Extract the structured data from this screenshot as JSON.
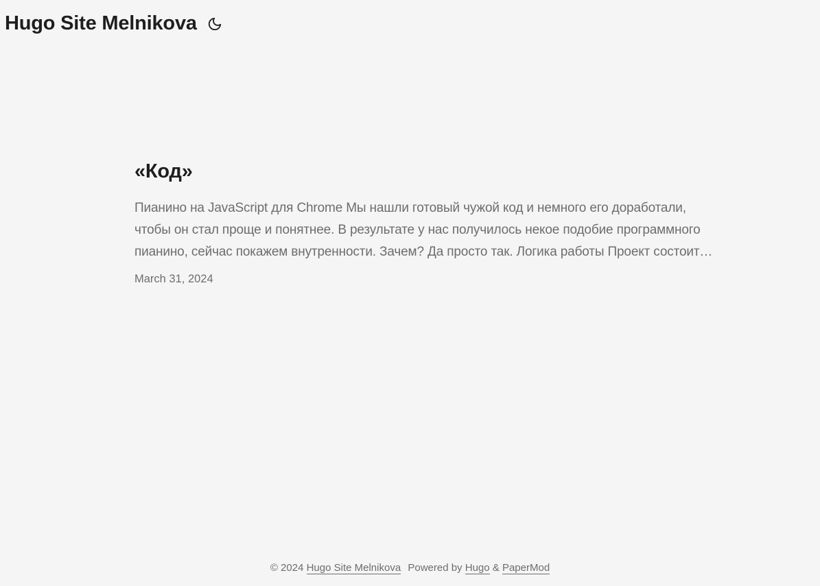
{
  "header": {
    "site_title": "Hugo Site Melnikova",
    "theme_toggle_icon": "moon-icon"
  },
  "post": {
    "title": "«Код»",
    "summary_lines": [
      "Пианино на JavaScript для Chrome Мы нашли готовый чужой код и немного его доработали,",
      "чтобы он стал проще и понятнее. В результате у нас получилось некое подобие программного",
      "пианино, сейчас покажем внутренности. Зачем? Да просто так. Логика работы Проект состоит…"
    ],
    "date": "March 31, 2024"
  },
  "footer": {
    "copyright": "© 2024",
    "site_link": "Hugo Site Melnikova",
    "powered_by": "Powered by",
    "hugo_link": "Hugo",
    "ampersand": "&",
    "theme_link": "PaperMod"
  },
  "colors": {
    "background": "#f5f5f5",
    "primary_text": "#1e1e1e",
    "secondary_text": "#6d6d6d"
  }
}
